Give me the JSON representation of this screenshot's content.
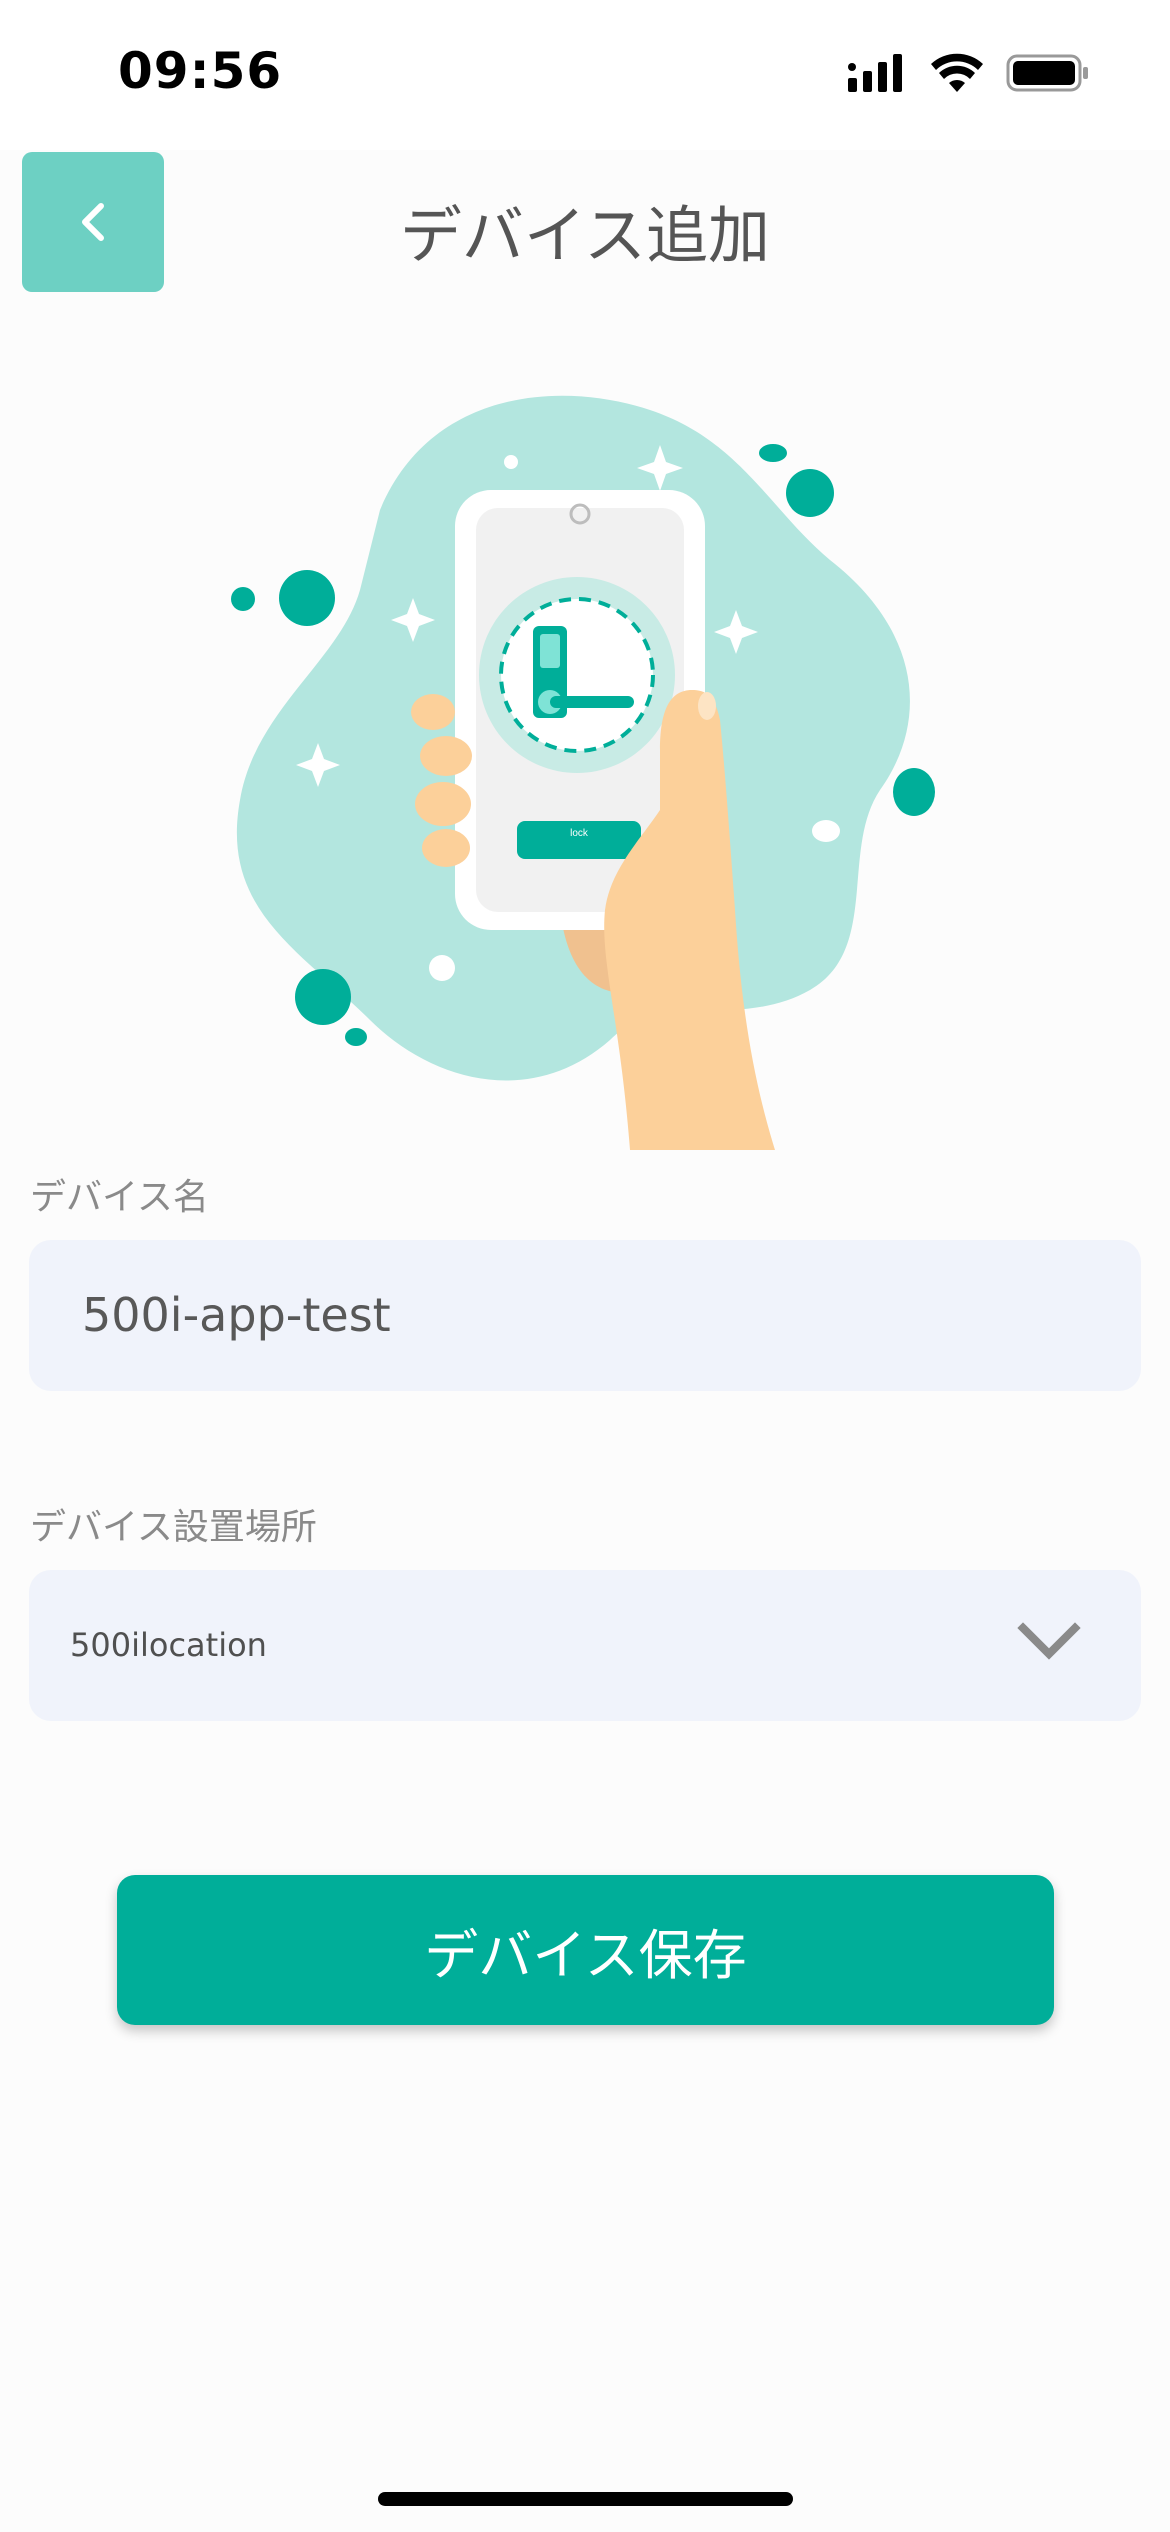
{
  "status_bar": {
    "time": "09:56",
    "icons": [
      "cellular-signal-icon",
      "wifi-icon",
      "battery-icon"
    ]
  },
  "header": {
    "back_icon": "chevron-left-icon",
    "title": "デバイス追加"
  },
  "illustration": {
    "button_text": "lock"
  },
  "form": {
    "device_name_label": "デバイス名",
    "device_name_value": "500i-app-test",
    "location_label": "デバイス設置場所",
    "location_value": "500ilocation",
    "location_dropdown_icon": "chevron-down-icon"
  },
  "actions": {
    "save_label": "デバイス保存"
  },
  "colors": {
    "accent": "#00ae99",
    "back_button": "#6dd0c3",
    "field_background": "#f0f3fb"
  }
}
